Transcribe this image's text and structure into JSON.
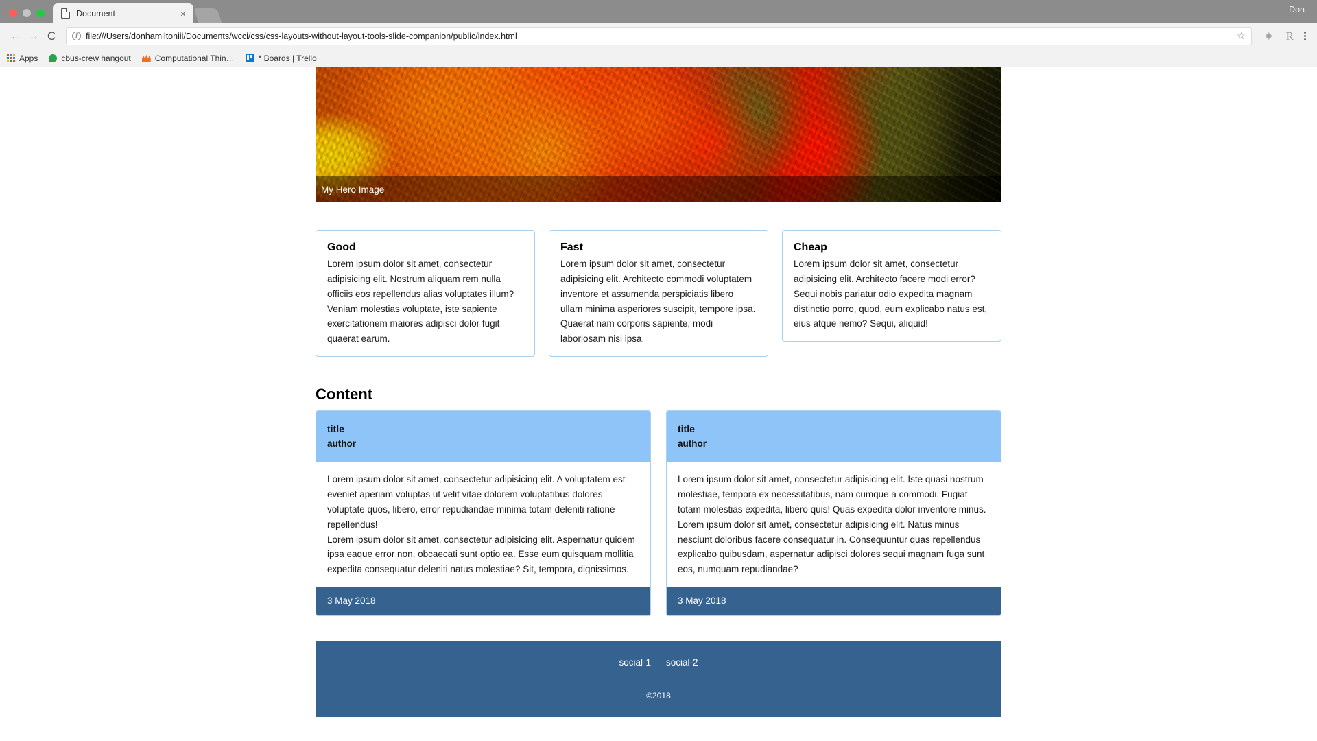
{
  "browser": {
    "tab": {
      "title": "Document",
      "icon": "page-icon",
      "close_label": "×"
    },
    "profile_name": "Don",
    "nav": {
      "back": "←",
      "forward": "→",
      "reload": "C"
    },
    "omnibox": {
      "security_icon": "i",
      "url": "file:///Users/donhamiltoniii/Documents/wcci/css/css-layouts-without-layout-tools-slide-companion/public/index.html",
      "star_icon": "☆",
      "extension_icon": "diamond-icon",
      "r_icon": "R",
      "menu_icon": "kebab-menu-icon"
    },
    "bookmarks": [
      {
        "label": "Apps",
        "icon": "apps-grid-icon"
      },
      {
        "label": "cbus-crew hangout",
        "icon": "green-bubble-icon"
      },
      {
        "label": "Computational Thin…",
        "icon": "computational-thinking-icon"
      },
      {
        "label": "* Boards | Trello",
        "icon": "trello-icon"
      }
    ]
  },
  "page": {
    "hero": {
      "caption": "My Hero Image"
    },
    "features": [
      {
        "title": "Good",
        "body": "Lorem ipsum dolor sit amet, consectetur adipisicing elit. Nostrum aliquam rem nulla officiis eos repellendus alias voluptates illum? Veniam molestias voluptate, iste sapiente exercitationem maiores adipisci dolor fugit quaerat earum."
      },
      {
        "title": "Fast",
        "body": "Lorem ipsum dolor sit amet, consectetur adipisicing elit. Architecto commodi voluptatem inventore et assumenda perspiciatis libero ullam minima asperiores suscipit, tempore ipsa. Quaerat nam corporis sapiente, modi laboriosam nisi ipsa."
      },
      {
        "title": "Cheap",
        "body": "Lorem ipsum dolor sit amet, consectetur adipisicing elit. Architecto facere modi error? Sequi nobis pariatur odio expedita magnam distinctio porro, quod, eum explicabo natus est, eius atque nemo? Sequi, aliquid!"
      }
    ],
    "content_heading": "Content",
    "articles": [
      {
        "title": "title",
        "author": "author",
        "paragraph1": "Lorem ipsum dolor sit amet, consectetur adipisicing elit. A voluptatem est eveniet aperiam voluptas ut velit vitae dolorem voluptatibus dolores voluptate quos, libero, error repudiandae minima totam deleniti ratione repellendus!",
        "paragraph2": "Lorem ipsum dolor sit amet, consectetur adipisicing elit. Aspernatur quidem ipsa eaque error non, obcaecati sunt optio ea. Esse eum quisquam mollitia expedita consequatur deleniti natus molestiae? Sit, tempora, dignissimos.",
        "date": "3 May 2018"
      },
      {
        "title": "title",
        "author": "author",
        "paragraph1": "Lorem ipsum dolor sit amet, consectetur adipisicing elit. Iste quasi nostrum molestiae, tempora ex necessitatibus, nam cumque a commodi. Fugiat totam molestias expedita, libero quis! Quas expedita dolor inventore minus.",
        "paragraph2": "Lorem ipsum dolor sit amet, consectetur adipisicing elit. Natus minus nesciunt doloribus facere consequatur in. Consequuntur quas repellendus explicabo quibusdam, aspernatur adipisci dolores sequi magnam fuga sunt eos, numquam repudiandae?",
        "date": "3 May 2018"
      }
    ],
    "footer": {
      "social": [
        "social-1",
        "social-2"
      ],
      "copyright": "©2018"
    }
  },
  "colors": {
    "card_border": "#a9d1ef",
    "article_header": "#8fc4f8",
    "article_footer": "#35628f",
    "chrome_tabstrip": "#8c8c8c",
    "chrome_toolbar": "#f2f2f2"
  }
}
